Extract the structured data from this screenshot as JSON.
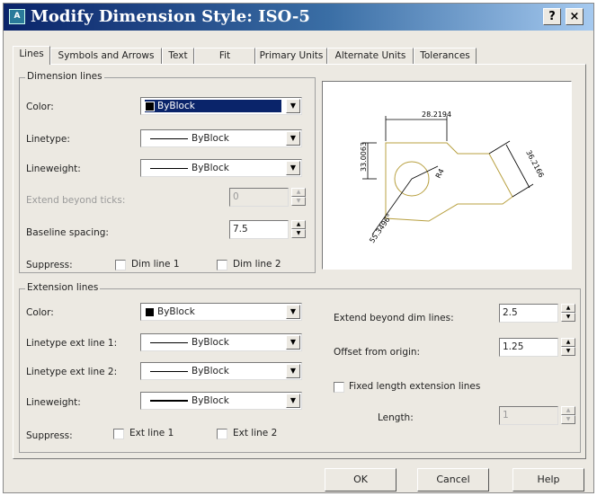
{
  "window": {
    "icon_text": "A",
    "title": "Modify Dimension Style: ISO-5",
    "help_glyph": "?",
    "close_glyph": "×"
  },
  "tabs": [
    {
      "label": "Lines",
      "active": true
    },
    {
      "label": "Symbols and Arrows",
      "active": false
    },
    {
      "label": "Text",
      "active": false
    },
    {
      "label": "Fit",
      "active": false
    },
    {
      "label": "Primary Units",
      "active": false
    },
    {
      "label": "Alternate Units",
      "active": false
    },
    {
      "label": "Tolerances",
      "active": false
    }
  ],
  "dimension_lines": {
    "legend": "Dimension lines",
    "color_label": "Color:",
    "color_value": "ByBlock",
    "linetype_label": "Linetype:",
    "linetype_value": "ByBlock",
    "lineweight_label": "Lineweight:",
    "lineweight_value": "ByBlock",
    "extend_label": "Extend beyond ticks:",
    "extend_value": "0",
    "baseline_label": "Baseline spacing:",
    "baseline_value": "7.5",
    "suppress_label": "Suppress:",
    "dim_line_1": "Dim line 1",
    "dim_line_2": "Dim line 2"
  },
  "extension_lines": {
    "legend": "Extension lines",
    "color_label": "Color:",
    "color_value": "ByBlock",
    "linetype1_label": "Linetype ext line 1:",
    "linetype1_value": "ByBlock",
    "linetype2_label": "Linetype ext line 2:",
    "linetype2_value": "ByBlock",
    "lineweight_label": "Lineweight:",
    "lineweight_value": "ByBlock",
    "suppress_label": "Suppress:",
    "ext_line_1": "Ext line 1",
    "ext_line_2": "Ext line 2",
    "extend_dim_label": "Extend beyond dim lines:",
    "extend_dim_value": "2.5",
    "offset_label": "Offset from origin:",
    "offset_value": "1.25",
    "fixed_length_label": "Fixed length extension lines",
    "length_label": "Length:",
    "length_value": "1"
  },
  "preview": {
    "dim_top": "28.2194",
    "dim_left": "33.0063",
    "dim_right": "36.2166",
    "dim_radius": "R4",
    "dim_angle": "55.3496°"
  },
  "buttons": {
    "ok": "OK",
    "cancel": "Cancel",
    "help": "Help"
  },
  "colors": {
    "title_start": "#0a246a",
    "title_end": "#a6caf0",
    "selection": "#0a246a",
    "preview_geometry": "#b8a040"
  }
}
